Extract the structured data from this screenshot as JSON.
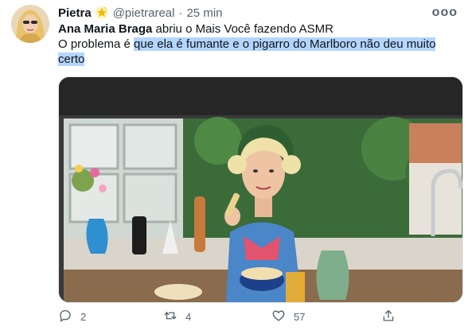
{
  "tweet": {
    "display_name": "Pietra",
    "handle": "@pietrareal",
    "separator": "·",
    "time": "25 min",
    "more_label": "ooo",
    "text_bold": "Ana Maria Braga",
    "text_line1_rest": " abriu o Mais Você fazendo ASMR",
    "text_line2_plain": "O problema é ",
    "text_line2_selected": "que ela é fumante e o pigarro do Marlboro não deu muito",
    "text_line3_selected": "certo",
    "colors": {
      "selection": "#b4d5fe",
      "secondary": "#536471",
      "accent_star": "#f5b800"
    },
    "icons": {
      "verified_star": "star-badge-icon"
    }
  },
  "actions": {
    "reply_count": "2",
    "retweet_count": "4",
    "like_count": "57",
    "icons": [
      "reply-icon",
      "retweet-icon",
      "like-icon",
      "share-icon"
    ]
  }
}
